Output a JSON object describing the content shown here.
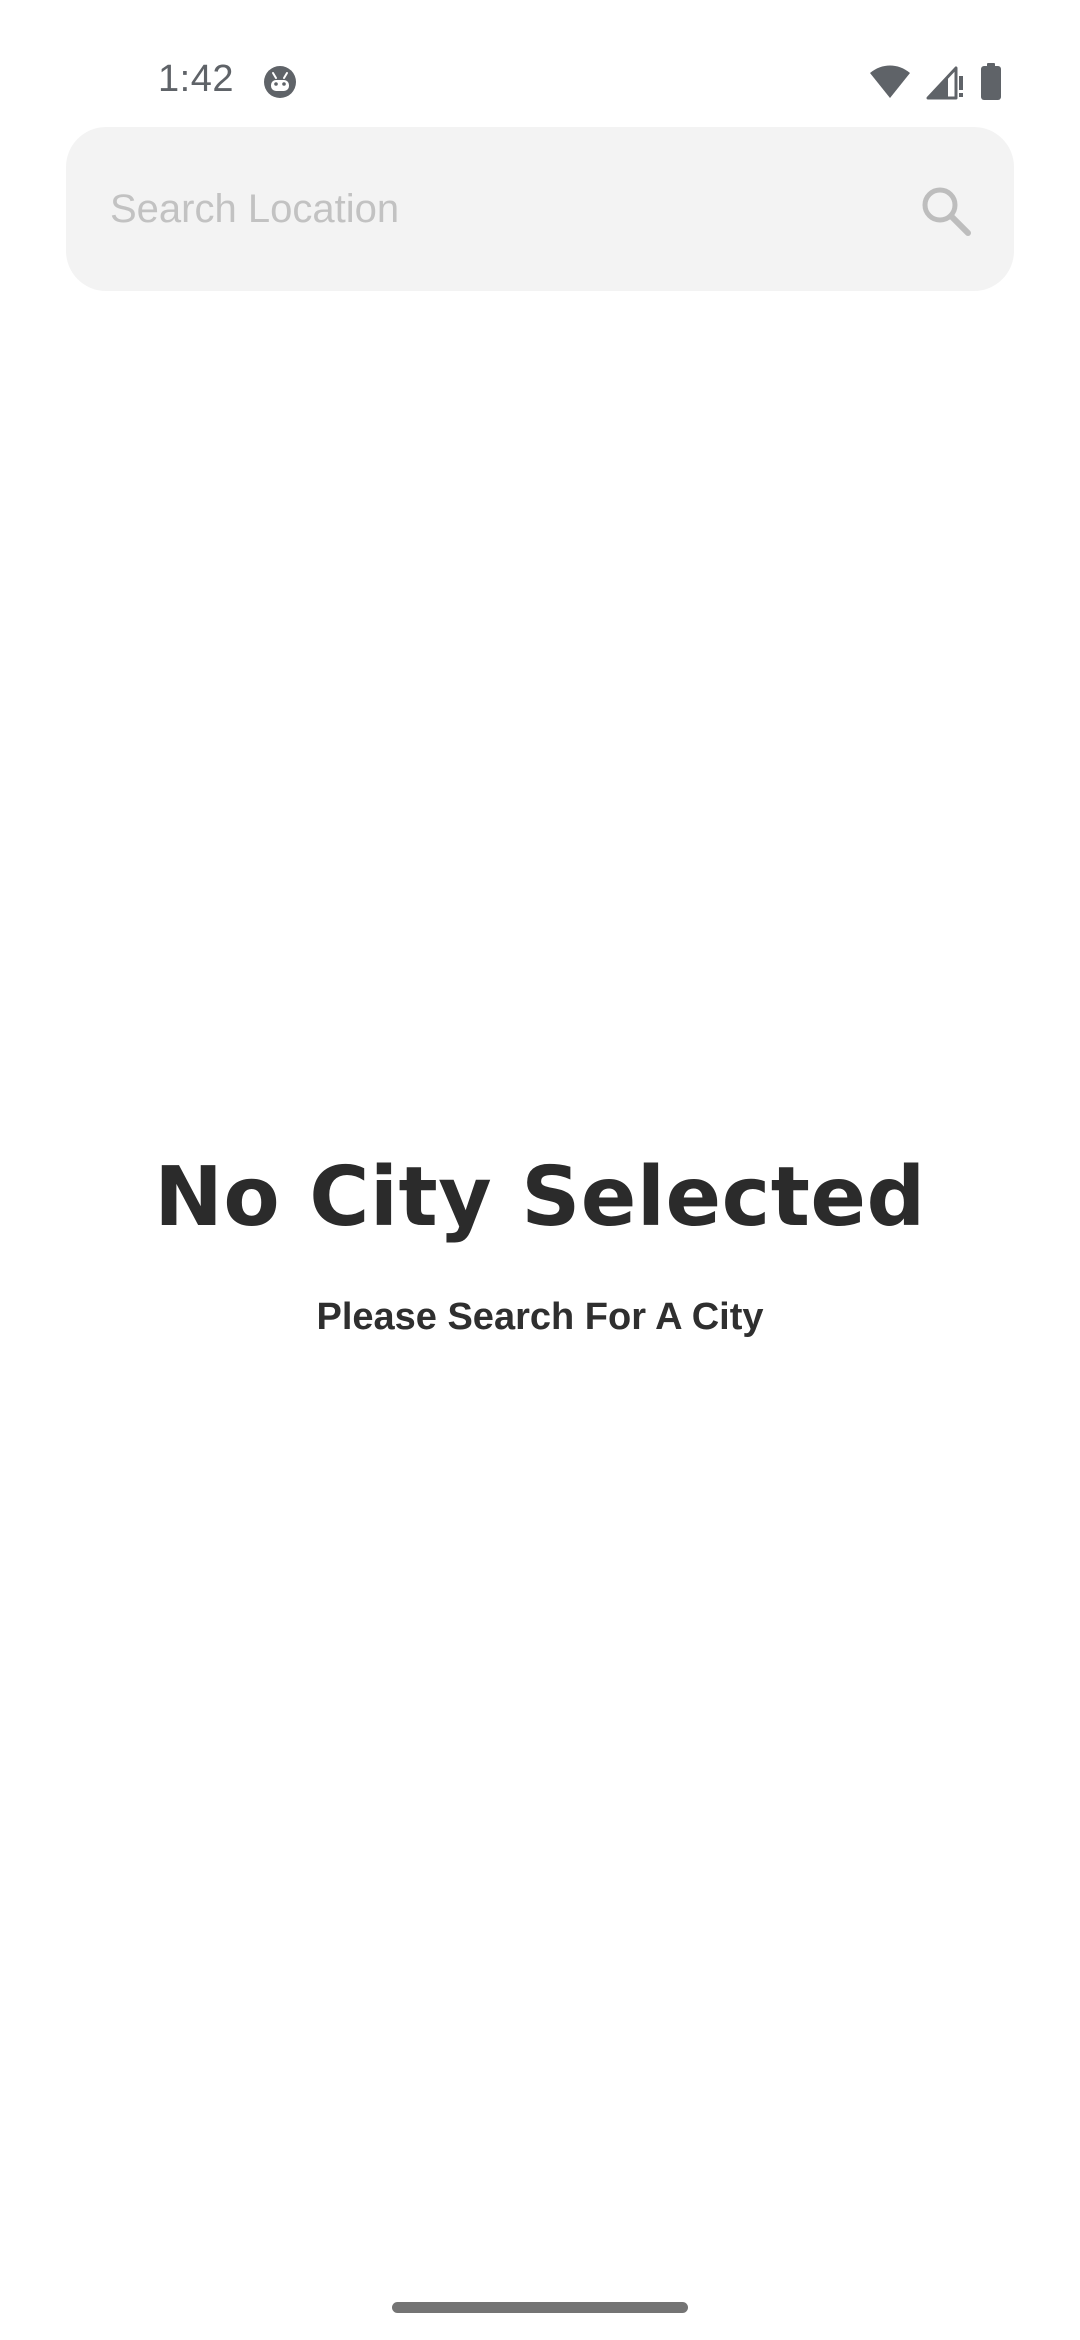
{
  "status_bar": {
    "time": "1:42",
    "app_icon": "android-debug-icon",
    "wifi_icon": "wifi-icon",
    "signal_icon": "cellular-signal-no-data-icon",
    "battery_icon": "battery-full-icon"
  },
  "search": {
    "value": "",
    "placeholder": "Search Location",
    "icon": "search-icon"
  },
  "empty_state": {
    "title": "No City Selected",
    "subtitle": "Please Search For A City"
  },
  "colors": {
    "background": "#ffffff",
    "search_background": "#f3f3f3",
    "placeholder": "#c2c2c2",
    "text_primary": "#2b2b2b",
    "icon_gray": "#bdbdbd",
    "status_gray": "#5f6368"
  }
}
